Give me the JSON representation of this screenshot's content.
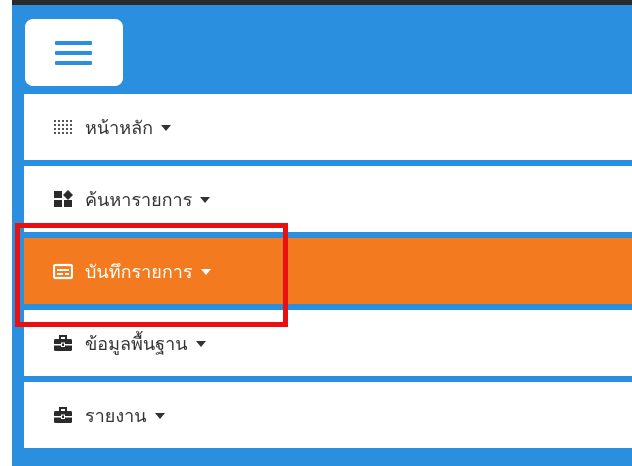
{
  "colors": {
    "panel_blue": "#2a8fdf",
    "active_orange": "#f47a20",
    "highlight_red": "#e81010",
    "menu_text": "#333333"
  },
  "toolbar": {
    "menu_toggle_icon": "hamburger-icon"
  },
  "menu": {
    "items": [
      {
        "label": "หน้าหลัก",
        "icon": "grid-dots-icon",
        "active": false
      },
      {
        "label": "ค้นหารายการ",
        "icon": "dashboard-icon",
        "active": false
      },
      {
        "label": "บันทึกรายการ",
        "icon": "form-icon",
        "active": true
      },
      {
        "label": "ข้อมูลพื้นฐาน",
        "icon": "briefcase-icon",
        "active": false
      },
      {
        "label": "รายงาน",
        "icon": "briefcase-icon",
        "active": false
      }
    ]
  }
}
